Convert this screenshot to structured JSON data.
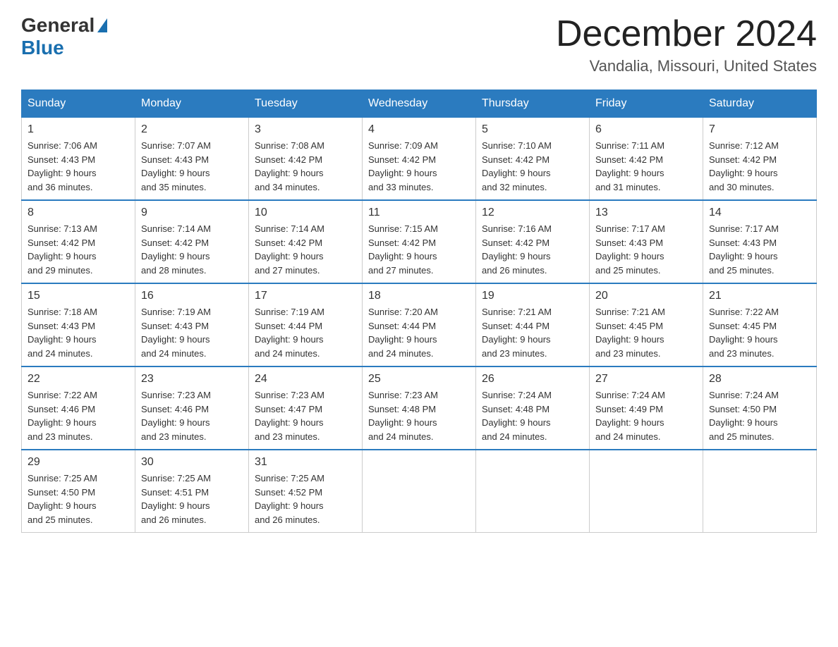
{
  "logo": {
    "general": "General",
    "blue": "Blue"
  },
  "header": {
    "title": "December 2024",
    "location": "Vandalia, Missouri, United States"
  },
  "days_of_week": [
    "Sunday",
    "Monday",
    "Tuesday",
    "Wednesday",
    "Thursday",
    "Friday",
    "Saturday"
  ],
  "weeks": [
    [
      {
        "day": "1",
        "sunrise": "7:06 AM",
        "sunset": "4:43 PM",
        "daylight": "9 hours and 36 minutes."
      },
      {
        "day": "2",
        "sunrise": "7:07 AM",
        "sunset": "4:43 PM",
        "daylight": "9 hours and 35 minutes."
      },
      {
        "day": "3",
        "sunrise": "7:08 AM",
        "sunset": "4:42 PM",
        "daylight": "9 hours and 34 minutes."
      },
      {
        "day": "4",
        "sunrise": "7:09 AM",
        "sunset": "4:42 PM",
        "daylight": "9 hours and 33 minutes."
      },
      {
        "day": "5",
        "sunrise": "7:10 AM",
        "sunset": "4:42 PM",
        "daylight": "9 hours and 32 minutes."
      },
      {
        "day": "6",
        "sunrise": "7:11 AM",
        "sunset": "4:42 PM",
        "daylight": "9 hours and 31 minutes."
      },
      {
        "day": "7",
        "sunrise": "7:12 AM",
        "sunset": "4:42 PM",
        "daylight": "9 hours and 30 minutes."
      }
    ],
    [
      {
        "day": "8",
        "sunrise": "7:13 AM",
        "sunset": "4:42 PM",
        "daylight": "9 hours and 29 minutes."
      },
      {
        "day": "9",
        "sunrise": "7:14 AM",
        "sunset": "4:42 PM",
        "daylight": "9 hours and 28 minutes."
      },
      {
        "day": "10",
        "sunrise": "7:14 AM",
        "sunset": "4:42 PM",
        "daylight": "9 hours and 27 minutes."
      },
      {
        "day": "11",
        "sunrise": "7:15 AM",
        "sunset": "4:42 PM",
        "daylight": "9 hours and 27 minutes."
      },
      {
        "day": "12",
        "sunrise": "7:16 AM",
        "sunset": "4:42 PM",
        "daylight": "9 hours and 26 minutes."
      },
      {
        "day": "13",
        "sunrise": "7:17 AM",
        "sunset": "4:43 PM",
        "daylight": "9 hours and 25 minutes."
      },
      {
        "day": "14",
        "sunrise": "7:17 AM",
        "sunset": "4:43 PM",
        "daylight": "9 hours and 25 minutes."
      }
    ],
    [
      {
        "day": "15",
        "sunrise": "7:18 AM",
        "sunset": "4:43 PM",
        "daylight": "9 hours and 24 minutes."
      },
      {
        "day": "16",
        "sunrise": "7:19 AM",
        "sunset": "4:43 PM",
        "daylight": "9 hours and 24 minutes."
      },
      {
        "day": "17",
        "sunrise": "7:19 AM",
        "sunset": "4:44 PM",
        "daylight": "9 hours and 24 minutes."
      },
      {
        "day": "18",
        "sunrise": "7:20 AM",
        "sunset": "4:44 PM",
        "daylight": "9 hours and 24 minutes."
      },
      {
        "day": "19",
        "sunrise": "7:21 AM",
        "sunset": "4:44 PM",
        "daylight": "9 hours and 23 minutes."
      },
      {
        "day": "20",
        "sunrise": "7:21 AM",
        "sunset": "4:45 PM",
        "daylight": "9 hours and 23 minutes."
      },
      {
        "day": "21",
        "sunrise": "7:22 AM",
        "sunset": "4:45 PM",
        "daylight": "9 hours and 23 minutes."
      }
    ],
    [
      {
        "day": "22",
        "sunrise": "7:22 AM",
        "sunset": "4:46 PM",
        "daylight": "9 hours and 23 minutes."
      },
      {
        "day": "23",
        "sunrise": "7:23 AM",
        "sunset": "4:46 PM",
        "daylight": "9 hours and 23 minutes."
      },
      {
        "day": "24",
        "sunrise": "7:23 AM",
        "sunset": "4:47 PM",
        "daylight": "9 hours and 23 minutes."
      },
      {
        "day": "25",
        "sunrise": "7:23 AM",
        "sunset": "4:48 PM",
        "daylight": "9 hours and 24 minutes."
      },
      {
        "day": "26",
        "sunrise": "7:24 AM",
        "sunset": "4:48 PM",
        "daylight": "9 hours and 24 minutes."
      },
      {
        "day": "27",
        "sunrise": "7:24 AM",
        "sunset": "4:49 PM",
        "daylight": "9 hours and 24 minutes."
      },
      {
        "day": "28",
        "sunrise": "7:24 AM",
        "sunset": "4:50 PM",
        "daylight": "9 hours and 25 minutes."
      }
    ],
    [
      {
        "day": "29",
        "sunrise": "7:25 AM",
        "sunset": "4:50 PM",
        "daylight": "9 hours and 25 minutes."
      },
      {
        "day": "30",
        "sunrise": "7:25 AM",
        "sunset": "4:51 PM",
        "daylight": "9 hours and 26 minutes."
      },
      {
        "day": "31",
        "sunrise": "7:25 AM",
        "sunset": "4:52 PM",
        "daylight": "9 hours and 26 minutes."
      },
      null,
      null,
      null,
      null
    ]
  ]
}
